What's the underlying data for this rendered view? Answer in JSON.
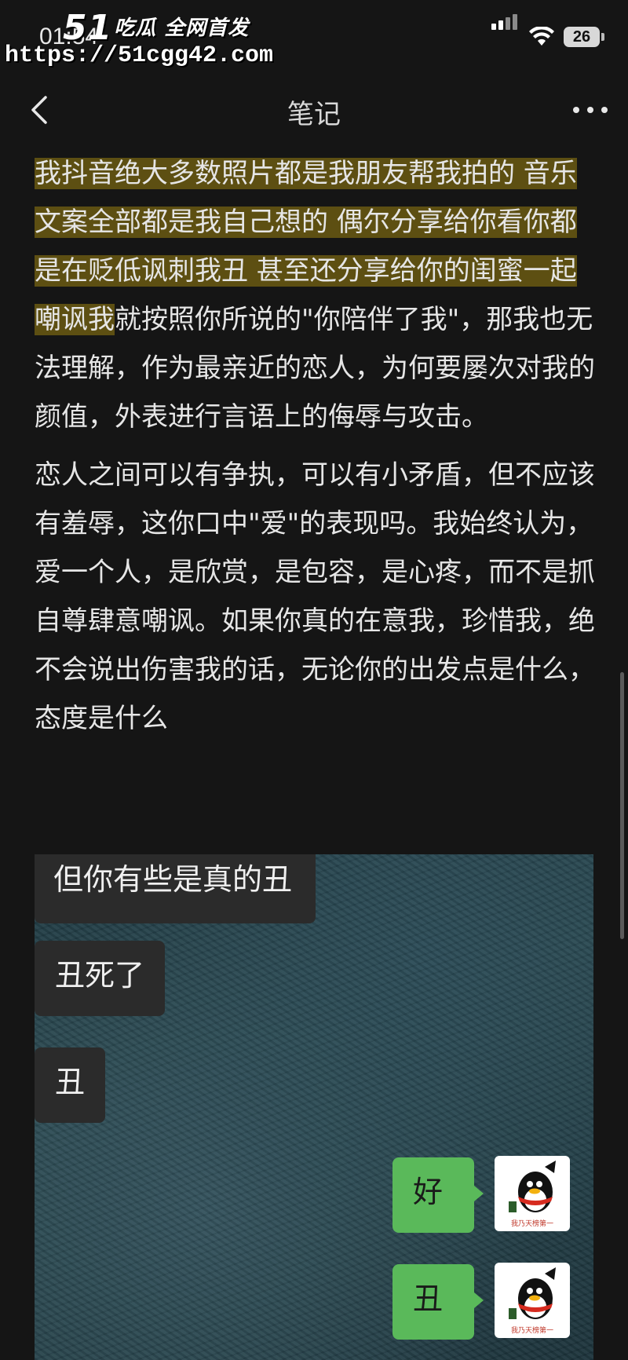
{
  "status_bar": {
    "time": "01:54",
    "battery": "26"
  },
  "watermark": {
    "logo_num": "51",
    "logo_text": "吃瓜 全网首发",
    "url": "https://51cgg42.com"
  },
  "nav": {
    "title": "笔记",
    "back_icon": "chevron-left-icon",
    "more_icon": "more-dots-icon"
  },
  "note": {
    "highlighted": "我抖音绝大多数照片都是我朋友帮我拍的 音乐文案全部都是我自己想的 偶尔分享给你看你都是在贬低讽刺我丑 甚至还分享给你的闺蜜一起嘲讽我",
    "paragraph1_rest": "就按照你所说的\"你陪伴了我\"，那我也无法理解，作为最亲近的恋人，为何要屡次对我的颜值，外表进行言语上的侮辱与攻击。",
    "paragraph2": "恋人之间可以有争执，可以有小矛盾，但不应该有羞辱，这你口中\"爱\"的表现吗。我始终认为，爱一个人，是欣赏，是包容，是心疼，而不是抓自尊肆意嘲讽。如果你真的在意我，珍惜我，绝不会说出伤害我的话，无论你的出发点是什么，态度是什么"
  },
  "chat": {
    "messages": [
      {
        "side": "in",
        "text": "但你有些是真的丑"
      },
      {
        "side": "in",
        "text": "丑死了"
      },
      {
        "side": "in",
        "text": "丑"
      },
      {
        "side": "out",
        "text": "好"
      },
      {
        "side": "out",
        "text": "丑"
      }
    ],
    "avatar_caption": "我乃天榜第一"
  },
  "colors": {
    "background": "#151515",
    "highlight": "#5d4f12",
    "out_bubble": "#5ab95a",
    "in_bubble": "#2b2b2b"
  }
}
